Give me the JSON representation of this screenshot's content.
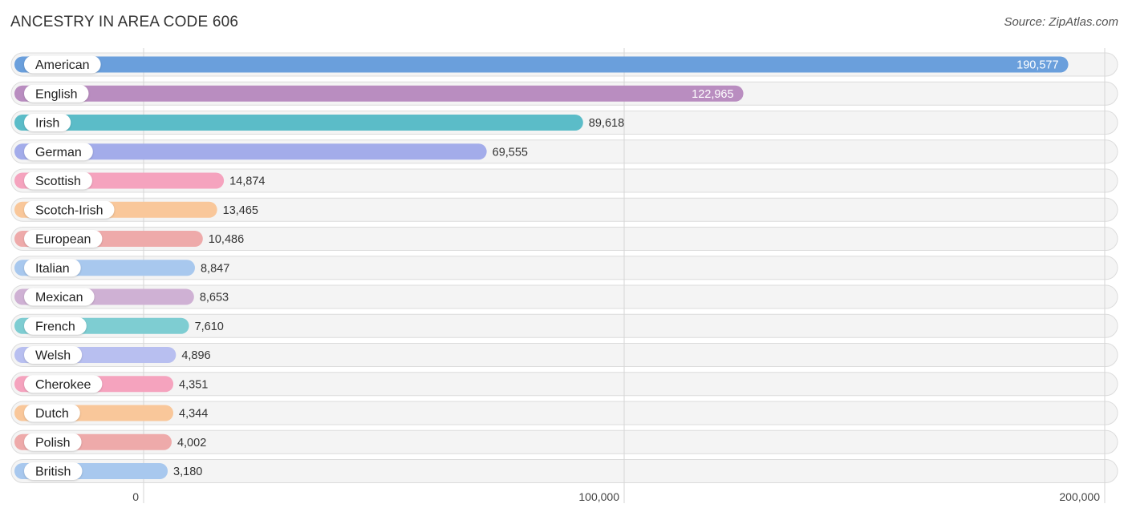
{
  "header": {
    "title": "ANCESTRY IN AREA CODE 606",
    "source": "Source: ZipAtlas.com"
  },
  "chart_data": {
    "type": "bar",
    "orientation": "horizontal",
    "title": "ANCESTRY IN AREA CODE 606",
    "source": "Source: ZipAtlas.com",
    "xlabel": "",
    "ylabel": "",
    "xlim": [
      0,
      200000
    ],
    "grid": true,
    "x_ticks": [
      0,
      100000,
      200000
    ],
    "x_tick_labels": [
      "0",
      "100,000",
      "200,000"
    ],
    "categories": [
      "American",
      "English",
      "Irish",
      "German",
      "Scottish",
      "Scotch-Irish",
      "European",
      "Italian",
      "Mexican",
      "French",
      "Welsh",
      "Cherokee",
      "Dutch",
      "Polish",
      "British"
    ],
    "values": [
      190577,
      122965,
      89618,
      69555,
      14874,
      13465,
      10486,
      8847,
      8653,
      7610,
      4896,
      4351,
      4344,
      4002,
      3180
    ],
    "value_labels": [
      "190,577",
      "122,965",
      "89,618",
      "69,555",
      "14,874",
      "13,465",
      "10,486",
      "8,847",
      "8,653",
      "7,610",
      "4,896",
      "4,351",
      "4,344",
      "4,002",
      "3,180"
    ],
    "colors": [
      "#6a9fdc",
      "#b98dc0",
      "#5bbcc8",
      "#a3acea",
      "#f5a3be",
      "#f9c79a",
      "#eeaaaa",
      "#a8c8ee",
      "#cfb1d4",
      "#7ecdd2",
      "#b8bff0",
      "#f5a3be",
      "#f9c79a",
      "#eeaaaa",
      "#a8c8ee"
    ],
    "value_label_inside": [
      true,
      true,
      false,
      false,
      false,
      false,
      false,
      false,
      false,
      false,
      false,
      false,
      false,
      false,
      false
    ]
  }
}
